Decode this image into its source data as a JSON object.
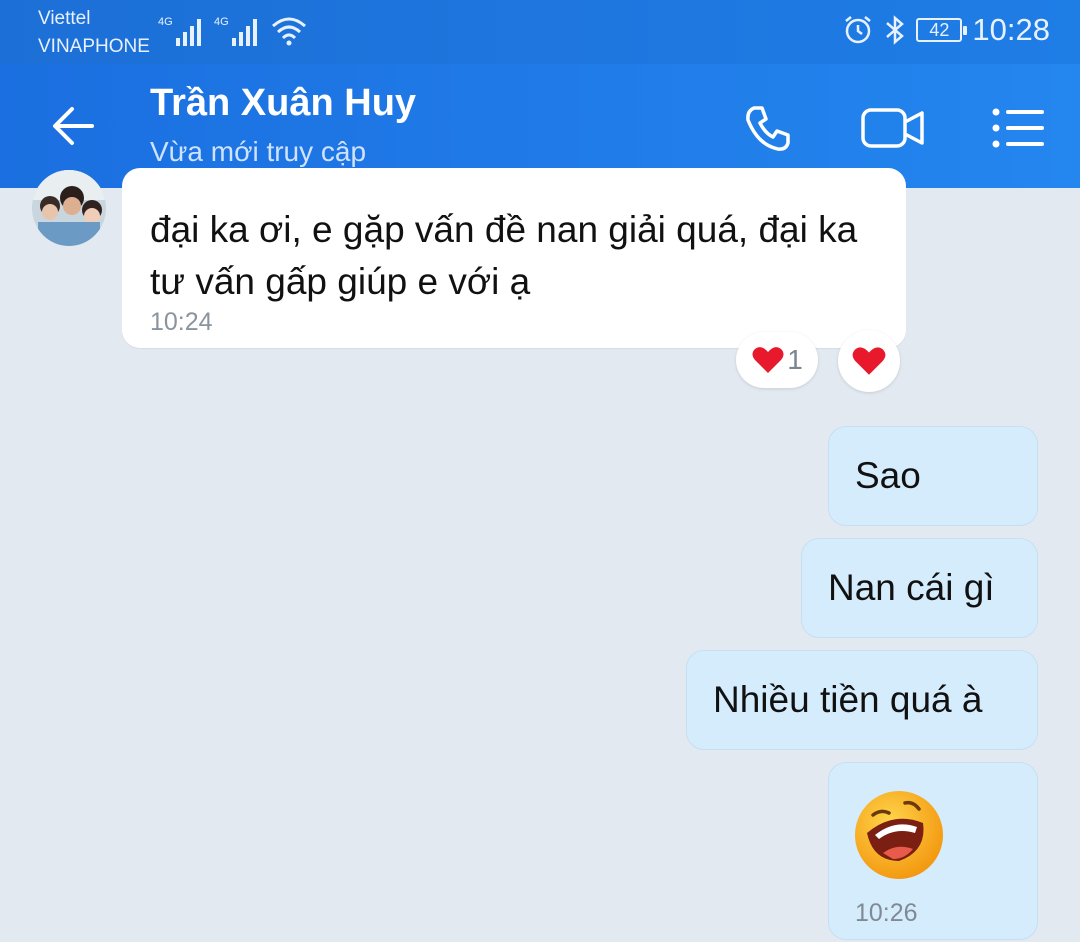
{
  "status_bar": {
    "carrier_1": "Viettel",
    "carrier_2": "VINAPHONE",
    "network_1": "4G",
    "network_2": "4G",
    "battery": "42",
    "time": "10:28",
    "icons": [
      "signal-icon",
      "wifi-icon",
      "alarm-icon",
      "bluetooth-icon",
      "battery-icon"
    ]
  },
  "header": {
    "contact_name": "Trần Xuân Huy",
    "contact_status": "Vừa mới truy cập",
    "actions": [
      "back-arrow-icon",
      "phone-icon",
      "video-call-icon",
      "menu-list-icon"
    ],
    "colors": {
      "header_bg": "#1f7de6",
      "header_text": "#ffffff"
    }
  },
  "messages": [
    {
      "direction": "incoming",
      "text": "đại ka ơi, e gặp vấn đề nan giải quá, đại ka tư vấn gấp giúp e với ạ",
      "time": "10:24",
      "reaction": {
        "icon": "heart-icon",
        "count": "1"
      }
    },
    {
      "direction": "outgoing",
      "text": "Sao"
    },
    {
      "direction": "outgoing",
      "text": "Nan cái gì"
    },
    {
      "direction": "outgoing",
      "text": "Nhiều tiền quá à"
    },
    {
      "direction": "outgoing",
      "sticker": "laughing-face-sticker",
      "time": "10:26"
    }
  ],
  "colors": {
    "chat_bg": "#e2e9f1",
    "incoming_bubble": "#ffffff",
    "outgoing_bubble": "#d5ecfd",
    "heart": "#e8192c"
  }
}
